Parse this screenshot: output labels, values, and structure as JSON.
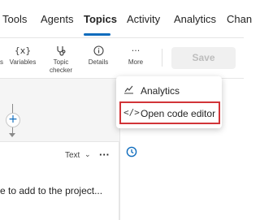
{
  "nav": {
    "tabs": [
      "Tools",
      "Agents",
      "Topics",
      "Activity",
      "Analytics",
      "Chan"
    ],
    "active_tab": "Topics"
  },
  "toolbar": {
    "variables_label": "Variables",
    "topic_checker_label": "Topic checker",
    "details_label": "Details",
    "more_label": "More",
    "save_label": "Save"
  },
  "card": {
    "type_label": "Text",
    "message": "e to add to the project..."
  },
  "menu": {
    "items": [
      {
        "label": "Analytics",
        "icon": "chart-line-icon"
      },
      {
        "label": "Open code editor",
        "icon": "code-icon"
      }
    ]
  },
  "colors": {
    "accent": "#0f6cbd",
    "highlight": "#d13438"
  }
}
